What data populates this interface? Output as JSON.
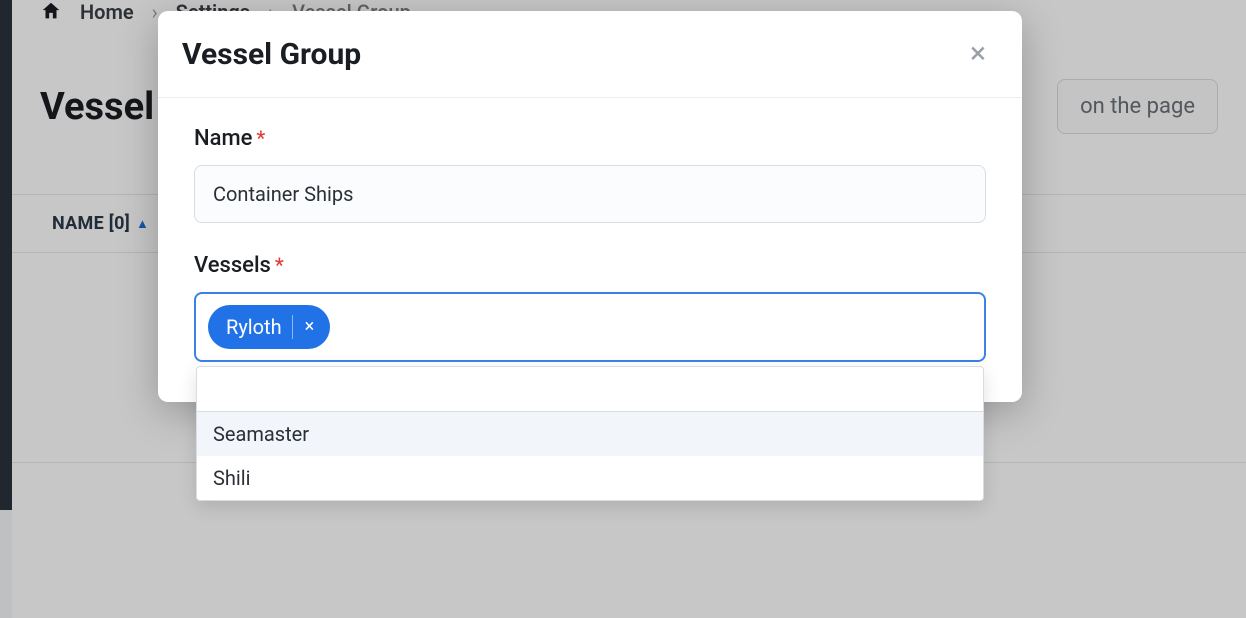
{
  "breadcrumb": {
    "home": "Home",
    "settings": "Settings",
    "current": "Vessel Group"
  },
  "page": {
    "title": "Vessel Group",
    "header_right": "on the page"
  },
  "table": {
    "col_name": "NAME [0]"
  },
  "modal": {
    "title": "Vessel Group",
    "name_label": "Name",
    "name_value": "Container Ships",
    "vessels_label": "Vessels",
    "chip": "Ryloth",
    "options": [
      "Seamaster",
      "Shili"
    ]
  }
}
